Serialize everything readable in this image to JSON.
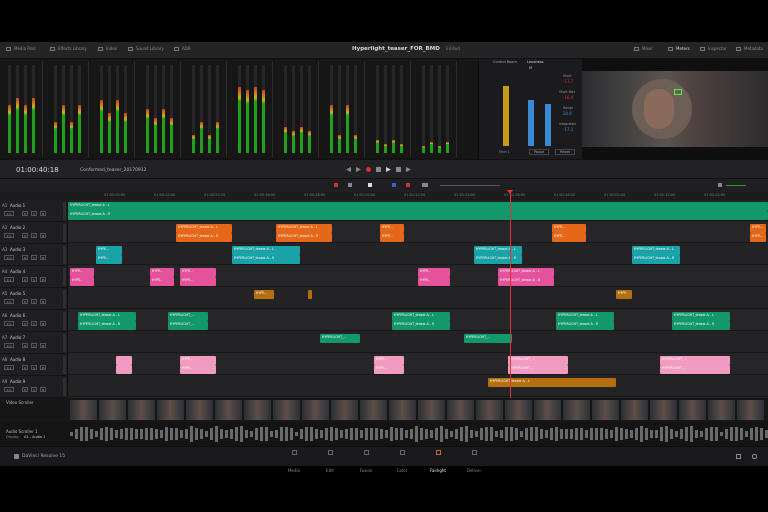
{
  "topbar": {
    "left_items": [
      "Media Pool",
      "Effects Library",
      "Index",
      "Sound Library",
      "ADR"
    ],
    "project_title": "Hyperlight_teaser_FOR_BMD",
    "edited_label": "Edited",
    "right_items": [
      "Mixer",
      "Meters",
      "Inspector",
      "Metadata"
    ]
  },
  "loudness": {
    "tab_control_room": "Control Room",
    "tab_loudness": "Loudness",
    "m_label": "M",
    "short_label": "Short",
    "short_value": "-17.7",
    "short_max_label": "Short Max",
    "short_max_value": "-16.4",
    "range_label": "Range",
    "range_value": "20.6",
    "integrated_label": "Integrated",
    "integrated_value": "-17.1",
    "pause_label": "Pause",
    "reset_label": "Reset",
    "main_label": "Main 1"
  },
  "timeline": {
    "timecode": "01:00:40:18",
    "name": "Conformed_teaser_20170912",
    "ruler": [
      "01:00:00:00",
      "01:00:12:00",
      "01:00:24:00",
      "01:00:36:00",
      "01:00:48:00",
      "01:01:00:00",
      "01:01:12:00",
      "01:01:24:00",
      "01:01:36:00",
      "01:01:48:00",
      "01:02:00:00",
      "01:02:12:00",
      "01:02:24:00"
    ]
  },
  "tracks": [
    {
      "id": "A1",
      "name": "Audio 1",
      "level": "2.0"
    },
    {
      "id": "A2",
      "name": "Audio 2",
      "level": "2.0"
    },
    {
      "id": "A3",
      "name": "Audio 3",
      "level": "2.0"
    },
    {
      "id": "A4",
      "name": "Audio 4",
      "level": "2.0"
    },
    {
      "id": "A5",
      "name": "Audio 5",
      "level": "2.0"
    },
    {
      "id": "A6",
      "name": "Audio 6",
      "level": "2.0"
    },
    {
      "id": "A7",
      "name": "Audio 7",
      "level": "2.0"
    },
    {
      "id": "A8",
      "name": "Audio 8",
      "level": "2.0"
    },
    {
      "id": "A9",
      "name": "Audio 9",
      "level": "2.0"
    }
  ],
  "track_buttons": [
    "R",
    "S",
    "M"
  ],
  "clip_labels": {
    "teaser_L": "HYPERLIGHT_teaser-A - L",
    "teaser_R": "HYPERLIGHT_teaser-A - R",
    "hyper_short": "HYPERLIGHT_...",
    "hyper_tiny": "HYPE..."
  },
  "colors": {
    "green": "#12986a",
    "orange": "#e4671a",
    "teal": "#1aa3a6",
    "pink": "#e3529a",
    "amber": "#b56f10",
    "lightpink": "#f09bbf",
    "accent": "#c63"
  },
  "video_scroller_label": "Video Scroller",
  "audio_scroller_label": "Audio Scroller 1",
  "audio_scroller_display": "Display",
  "audio_scroller_track": "A1 - Audio 1",
  "app_name": "DaVinci Resolve 15",
  "pages": [
    "Media",
    "Edit",
    "Fusion",
    "Color",
    "Fairlight",
    "Deliver"
  ],
  "active_page": "Fairlight"
}
